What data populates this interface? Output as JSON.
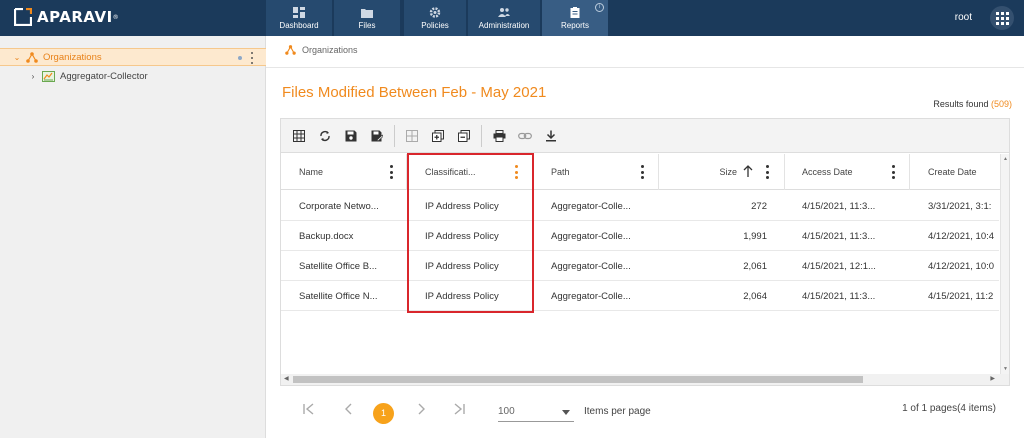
{
  "app": {
    "logo_text": "APARAVI",
    "registered_mark": "®"
  },
  "nav": [
    {
      "label": "Dashboard",
      "icon": "dashboard-icon"
    },
    {
      "label": "Files",
      "icon": "folder-icon"
    },
    {
      "label": "Policies",
      "icon": "gear-icon"
    },
    {
      "label": "Administration",
      "icon": "users-icon"
    },
    {
      "label": "Reports",
      "icon": "clipboard-icon",
      "active": true
    }
  ],
  "user": "root",
  "sidebar": {
    "root": {
      "label": "Organizations"
    },
    "child": {
      "label": "Aggregator-Collector"
    }
  },
  "breadcrumb": "Organizations",
  "report": {
    "title": "Files Modified Between Feb - May 2021",
    "results_label": "Results found",
    "results_count": "(509)"
  },
  "columns": [
    {
      "label": "Name"
    },
    {
      "label": "Classificati..."
    },
    {
      "label": "Path"
    },
    {
      "label": "Size"
    },
    {
      "label": "Access Date"
    },
    {
      "label": "Create Date"
    }
  ],
  "rows": [
    {
      "name": "Corporate Netwo...",
      "classification": "IP Address Policy",
      "path": "Aggregator-Colle...",
      "size": "272",
      "access": "4/15/2021, 11:3...",
      "create": "3/31/2021, 3:1:"
    },
    {
      "name": "Backup.docx",
      "classification": "IP Address Policy",
      "path": "Aggregator-Colle...",
      "size": "1,991",
      "access": "4/15/2021, 11:3...",
      "create": "4/12/2021, 10:4"
    },
    {
      "name": "Satellite Office B...",
      "classification": "IP Address Policy",
      "path": "Aggregator-Colle...",
      "size": "2,061",
      "access": "4/15/2021, 12:1...",
      "create": "4/12/2021, 10:0"
    },
    {
      "name": "Satellite Office N...",
      "classification": "IP Address Policy",
      "path": "Aggregator-Colle...",
      "size": "2,064",
      "access": "4/15/2021, 11:3...",
      "create": "4/15/2021, 11:2"
    }
  ],
  "pager": {
    "current_page": "1",
    "page_size": "100",
    "items_per_page_label": "Items per page",
    "info": "1 of 1 pages(4 items)"
  },
  "colors": {
    "topbar": "#1b3a5b",
    "accent": "#f08a1e",
    "highlight": "#d9262c"
  }
}
